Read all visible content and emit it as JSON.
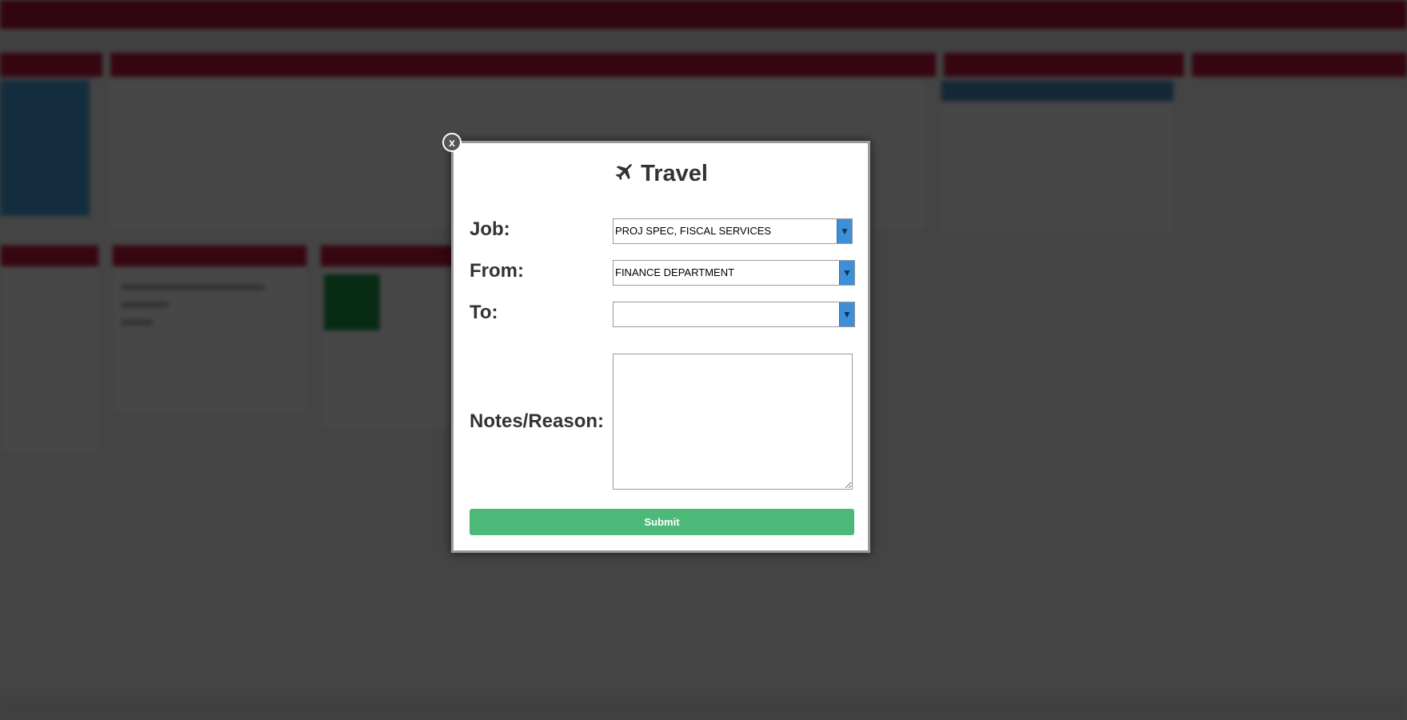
{
  "modal": {
    "close_label": "x",
    "title": "Travel",
    "title_icon": "airplane-icon",
    "job": {
      "label": "Job:",
      "value": "PROJ SPEC, FISCAL SERVICES"
    },
    "from": {
      "label": "From:",
      "value": "FINANCE DEPARTMENT"
    },
    "to": {
      "label": "To:",
      "value": ""
    },
    "notes": {
      "label": "Notes/Reason:",
      "value": ""
    },
    "submit_label": "Submit",
    "dropdown_arrow": "▼"
  },
  "colors": {
    "submit": "#4cb978",
    "dropdown_arrow_bg": "#3d8fd8",
    "overlay": "rgba(0,0,0,0.72)",
    "brand_bar": "#b0133c"
  }
}
